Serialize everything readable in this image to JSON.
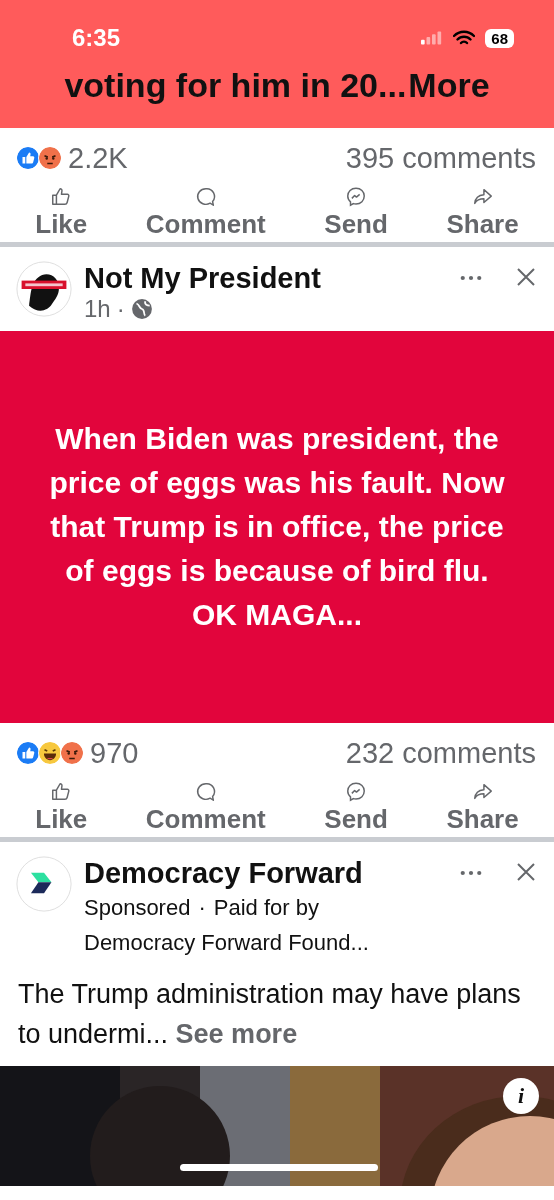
{
  "status_bar": {
    "time": "6:35",
    "battery": "68"
  },
  "posts": [
    {
      "kind": "partial",
      "text": "voting for him in 20...",
      "more_link": "More",
      "reactions": [
        {
          "kind": "like"
        },
        {
          "kind": "angry"
        }
      ],
      "reaction_count": "2.2K",
      "comments": "395 comments",
      "actions": [
        "Like",
        "Comment",
        "Send",
        "Share"
      ]
    },
    {
      "kind": "text",
      "author": "Not My President",
      "time": "1h",
      "separator": "·",
      "text": "When Biden was president, the price of eggs was his fault. Now that Trump is in office, the price of eggs is because of bird flu. OK MAGA...",
      "reactions": [
        {
          "kind": "like"
        },
        {
          "kind": "haha"
        },
        {
          "kind": "angry"
        }
      ],
      "reaction_count": "970",
      "comments": "232 comments",
      "actions": [
        "Like",
        "Comment",
        "Send",
        "Share"
      ]
    },
    {
      "kind": "ad",
      "author": "Democracy Forward",
      "sponsored": "Sponsored",
      "separator": "·",
      "paid": "Paid for by",
      "payer": "Democracy Forward Found...",
      "text": "The Trump administration may have plans to undermi...",
      "see_more": "See more",
      "info_label": "i"
    }
  ]
}
